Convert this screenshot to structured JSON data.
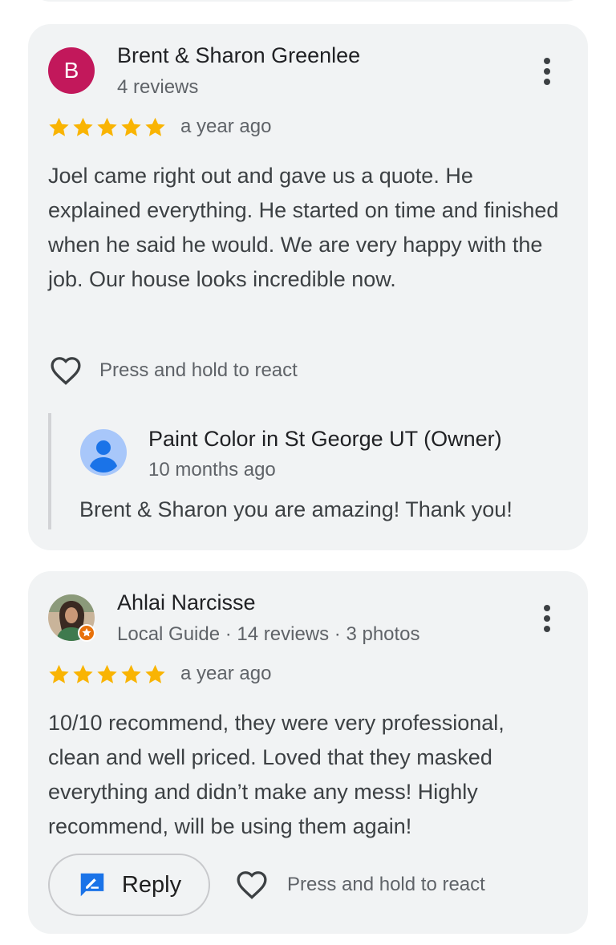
{
  "reviews": [
    {
      "avatar_letter": "B",
      "avatar_color": "#c2185b",
      "name": "Brent & Sharon Greenlee",
      "meta": "4 reviews",
      "rating": 5,
      "date": "a year ago",
      "text": "Joel came right out and gave us a quote. He explained everything. He started on time and finished when he said he would. We are very happy with the job. Our house looks incredible now.",
      "react_label": "Press and hold to react",
      "owner_reply": {
        "name": "Paint Color in St George UT (Owner)",
        "date": "10 months ago",
        "text": "Brent & Sharon you are amazing! Thank you!"
      }
    },
    {
      "avatar": "profile-photo",
      "name": "Ahlai Narcisse",
      "meta": "Local Guide · 14 reviews · 3 photos",
      "rating": 5,
      "date": "a year ago",
      "text": "10/10 recommend, they were very professional, clean and well priced. Loved that they masked everything and didn’t make any mess! Highly recommend, will be using them again!",
      "reply_label": "Reply",
      "react_label": "Press and hold to react"
    }
  ],
  "colors": {
    "star": "#f9b403",
    "card_bg": "#f1f3f4",
    "reply_icon": "#1a73e8",
    "local_guide_badge": "#e8710a"
  }
}
